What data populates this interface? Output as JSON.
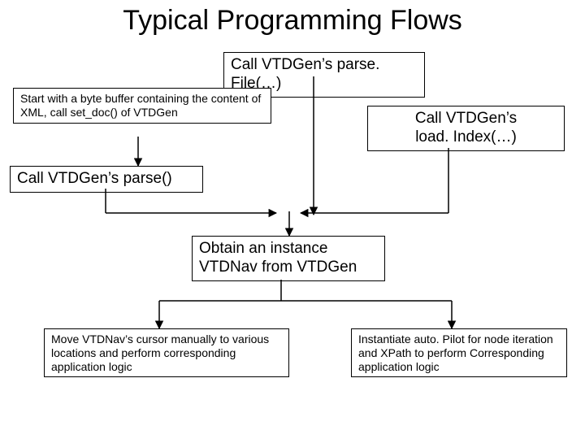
{
  "title": "Typical Programming Flows",
  "boxes": {
    "start": "Start with a byte buffer containing the\n content of XML, call set_doc() of\n VTDGen",
    "parseFile": "Call VTDGen’s parse. File(…)",
    "loadIndex1": "Call VTDGen’s",
    "loadIndex2": "load. Index(…)",
    "parse": "Call VTDGen’s parse()",
    "obtain": "Obtain an instance VTDNav from VTDGen",
    "moveNav": "Move VTDNav’s cursor manually to various locations and perform corresponding application logic",
    "autopilot": "Instantiate auto. Pilot for node iteration and XPath to perform Corresponding application logic"
  }
}
